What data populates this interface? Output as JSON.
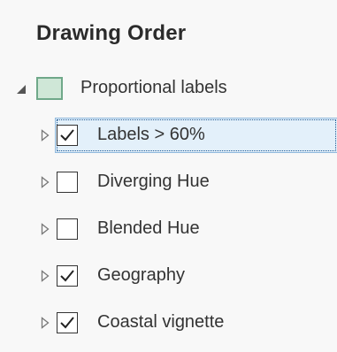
{
  "panel": {
    "title": "Drawing Order",
    "map": {
      "label": "Proportional labels",
      "icon": "map-icon",
      "expanded": true
    },
    "layers": [
      {
        "label": "Labels > 60%",
        "checked": true,
        "selected": true
      },
      {
        "label": "Diverging Hue",
        "checked": false,
        "selected": false
      },
      {
        "label": "Blended Hue",
        "checked": false,
        "selected": false
      },
      {
        "label": "Geography",
        "checked": true,
        "selected": false
      },
      {
        "label": "Coastal vignette",
        "checked": true,
        "selected": false
      }
    ]
  },
  "colors": {
    "selection": "#e3f0fa",
    "selection_border": "#8fb8dc",
    "map_icon_fill": "#cfe7d7",
    "map_icon_border": "#6fa889"
  }
}
